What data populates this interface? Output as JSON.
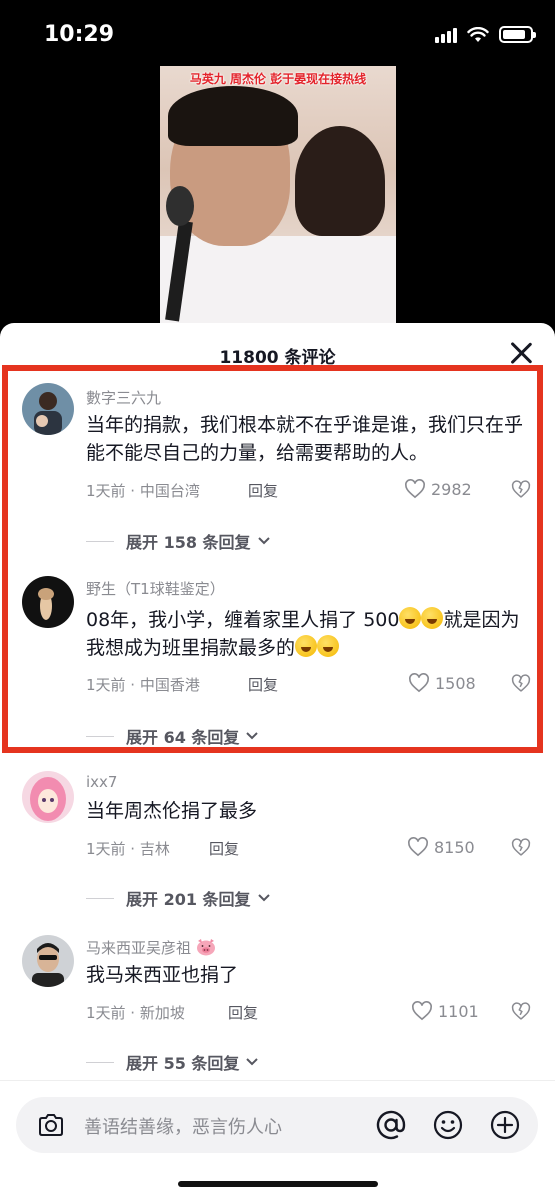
{
  "status_bar": {
    "time": "10:29",
    "battery_level": 0.85
  },
  "video": {
    "caption": "马英九 周杰伦 彭于晏现在接热线"
  },
  "sheet": {
    "title": "11800 条评论"
  },
  "comments": [
    {
      "name": "數字三六九",
      "text": "当年的捐款，我们根本就不在乎谁是谁，我们只在乎能不能尽自己的力量，给需要帮助的人。",
      "meta": "1天前 · 中国台湾",
      "reply": "回复",
      "likes": "2982",
      "expand": "展开 158 条回复"
    },
    {
      "name": "野生（T1球鞋鉴定）",
      "text_part1": "08年，我小学，缠着家里人捐了 500",
      "text_part2": "就是因为我想成为班里捐款最多的",
      "emoji": "rolling-on-floor-laughing",
      "meta": "1天前 · 中国香港",
      "reply": "回复",
      "likes": "1508",
      "expand": "展开 64 条回复"
    },
    {
      "name": "ixx7",
      "text": "当年周杰伦捐了最多",
      "meta": "1天前 · 吉林",
      "reply": "回复",
      "likes": "8150",
      "expand": "展开 201 条回复"
    },
    {
      "name": "马来西亚吴彦祖",
      "name_emoji": "pig-face",
      "text": "我马来西亚也捐了",
      "meta": "1天前 · 新加坡",
      "reply": "回复",
      "likes": "1101",
      "expand": "展开 55 条回复"
    }
  ],
  "input": {
    "placeholder": "善语结善缘，恶言伤人心"
  },
  "colors": {
    "highlight": "#e5341f",
    "text_primary": "#161823",
    "text_secondary": "#8a8b91"
  }
}
